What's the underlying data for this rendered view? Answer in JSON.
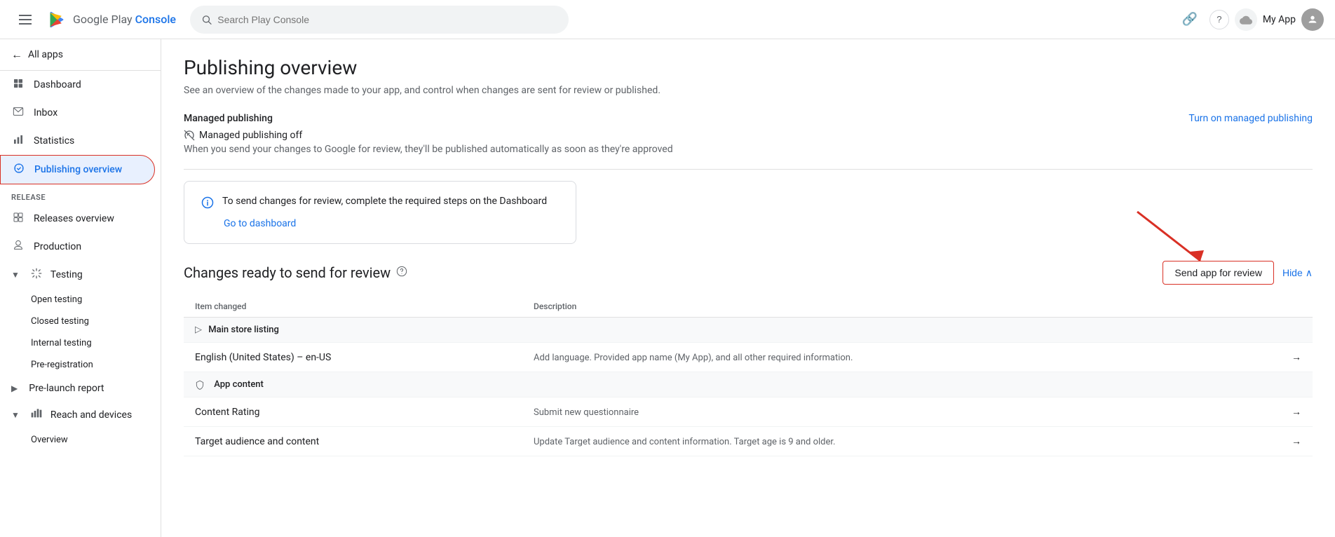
{
  "topbar": {
    "hamburger_label": "☰",
    "logo_text_plain": "Google Play ",
    "logo_text_colored": "Console",
    "search_placeholder": "Search Play Console",
    "link_icon": "🔗",
    "help_icon": "?",
    "cloud_icon": "☁",
    "app_name": "My App",
    "avatar_initial": "👤",
    "turn_on_managed": "Turn on managed publishing"
  },
  "sidebar": {
    "back_label": "All apps",
    "items": [
      {
        "label": "Dashboard",
        "icon": "⊞"
      },
      {
        "label": "Inbox",
        "icon": "☐"
      },
      {
        "label": "Statistics",
        "icon": "📊"
      },
      {
        "label": "Publishing overview",
        "icon": "🔄",
        "active": true
      }
    ],
    "release_section": "Release",
    "release_items": [
      {
        "label": "Releases overview",
        "icon": "⊞"
      },
      {
        "label": "Production",
        "icon": "🔔"
      },
      {
        "label": "Testing",
        "icon": "↺",
        "expandable": true,
        "chevron": "▼"
      }
    ],
    "testing_sub_items": [
      {
        "label": "Open testing"
      },
      {
        "label": "Closed testing"
      },
      {
        "label": "Internal testing"
      },
      {
        "label": "Pre-registration"
      }
    ],
    "pre_launch": {
      "label": "Pre-launch report",
      "expandable": true,
      "chevron": "▶"
    },
    "reach_devices": {
      "label": "Reach and devices",
      "icon": "📶",
      "expandable": true,
      "chevron": "▼"
    },
    "reach_sub_items": [
      {
        "label": "Overview"
      }
    ]
  },
  "page": {
    "title": "Publishing overview",
    "subtitle": "See an overview of the changes made to your app, and control when changes are sent for review or published.",
    "managed_section": "Managed publishing",
    "managed_off_label": "Managed publishing off",
    "managed_desc": "When you send your changes to Google for review, they'll be published automatically as soon as they're approved",
    "info_text": "To send changes for review, complete the required steps on the Dashboard",
    "info_link": "Go to dashboard",
    "changes_title": "Changes ready to send for review",
    "send_review_label": "Send app for review",
    "hide_label": "Hide",
    "hide_chevron": "∧",
    "table_col1": "Item changed",
    "table_col2": "Description",
    "table_rows": [
      {
        "type": "group",
        "icon": "▷",
        "label": "Main store listing",
        "desc": ""
      },
      {
        "type": "data",
        "item": "English (United States) – en-US",
        "desc": "Add language. Provided app name (My App), and all other required information.",
        "link": "→"
      },
      {
        "type": "group",
        "icon": "🛡",
        "label": "App content",
        "desc": ""
      },
      {
        "type": "data",
        "item": "Content Rating",
        "desc": "Submit new questionnaire",
        "link": "→"
      },
      {
        "type": "data",
        "item": "Target audience and content",
        "desc": "Update Target audience and content information. Target age is 9 and older.",
        "link": "→"
      }
    ]
  }
}
